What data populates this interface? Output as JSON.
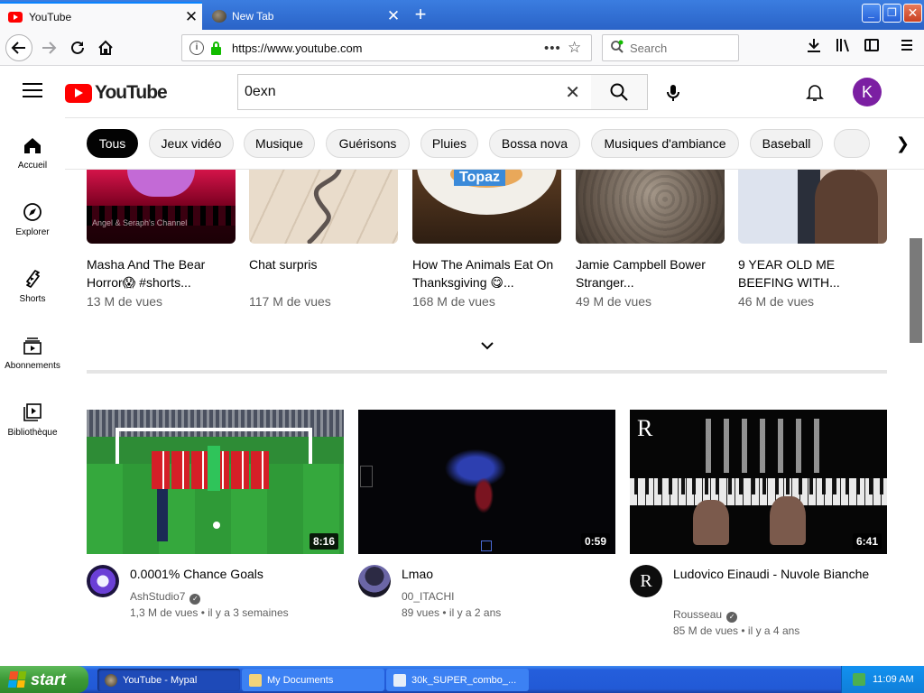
{
  "browser": {
    "tabs": [
      {
        "label": "YouTube",
        "active": true
      },
      {
        "label": "New Tab",
        "active": false
      }
    ],
    "new_tab_symbol": "+",
    "url": "https://www.youtube.com",
    "search_placeholder": "Search",
    "window_buttons": {
      "minimize": "_",
      "maximize": "❐",
      "close": "✕"
    }
  },
  "youtube": {
    "logo_text": "YouTube",
    "search_value": "0exn",
    "avatar_letter": "K",
    "chips": [
      "Tous",
      "Jeux vidéo",
      "Musique",
      "Guérisons",
      "Pluies",
      "Bossa nova",
      "Musiques d'ambiance",
      "Baseball"
    ],
    "sidebar": [
      {
        "label": "Accueil",
        "icon": "home-icon"
      },
      {
        "label": "Explorer",
        "icon": "compass-icon"
      },
      {
        "label": "Shorts",
        "icon": "shorts-icon"
      },
      {
        "label": "Abonnements",
        "icon": "subscriptions-icon"
      },
      {
        "label": "Bibliothèque",
        "icon": "library-icon"
      }
    ],
    "shorts": [
      {
        "title": "Masha And The Bear Horror😱 #shorts...",
        "views": "13 M de vues",
        "thumb_text": "Angel & Seraph's Channel"
      },
      {
        "title": "Chat surpris",
        "views": "117 M de vues",
        "thumb_text": ""
      },
      {
        "title": "How The Animals Eat On Thanksgiving 😋...",
        "views": "168 M de vues",
        "thumb_text": "Topaz"
      },
      {
        "title": "Jamie Campbell Bower Stranger...",
        "views": "49 M de vues",
        "thumb_text": ""
      },
      {
        "title": "9 YEAR OLD ME BEEFING WITH...",
        "views": "46 M de vues",
        "thumb_text": ""
      }
    ],
    "videos": [
      {
        "title": "0.0001% Chance Goals",
        "channel": "AshStudio7",
        "verified": true,
        "views": "1,3 M de vues",
        "age": "il y a 3 semaines",
        "duration": "8:16"
      },
      {
        "title": "Lmao",
        "channel": "00_ITACHI",
        "verified": false,
        "views": "89 vues",
        "age": "il y a 2 ans",
        "duration": "0:59"
      },
      {
        "title": "Ludovico Einaudi - Nuvole Bianche",
        "channel": "Rousseau",
        "verified": true,
        "views": "85 M de vues",
        "age": "il y a 4 ans",
        "duration": "6:41"
      }
    ]
  },
  "taskbar": {
    "start_label": "start",
    "tasks": [
      {
        "label": "YouTube - Mypal",
        "active": true
      },
      {
        "label": "My Documents",
        "active": false
      },
      {
        "label": "30k_SUPER_combo_...",
        "active": false
      }
    ],
    "clock": "11:09 AM"
  },
  "colors": {
    "youtube_red": "#ff0000",
    "avatar_purple": "#7b1fa2",
    "xp_blue": "#245edc",
    "xp_start_green": "#3c9a37"
  }
}
